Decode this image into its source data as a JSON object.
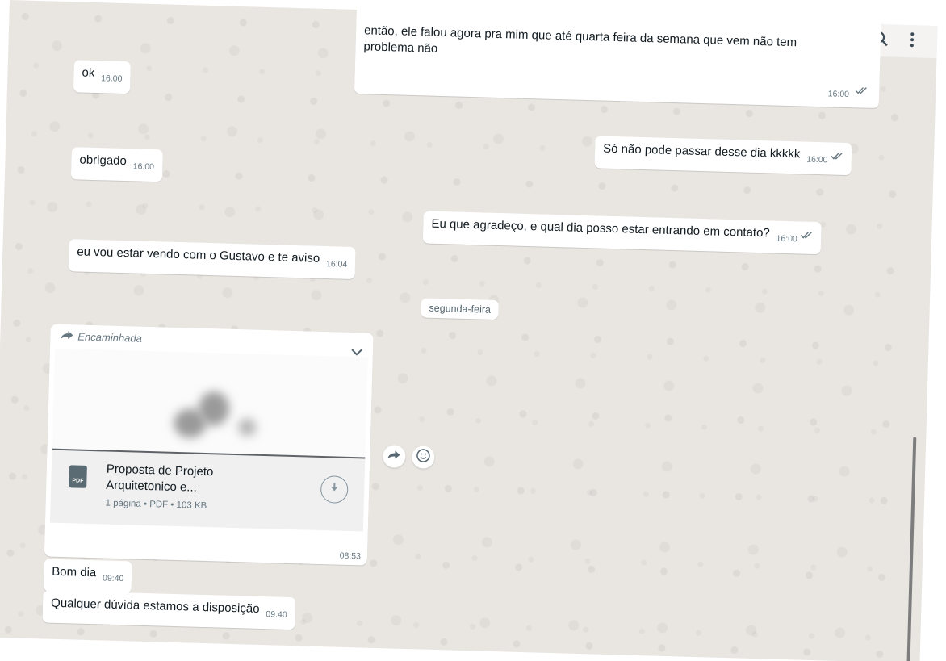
{
  "header": {
    "icons": [
      "video-call-icon",
      "chevron-down-icon",
      "search-icon",
      "menu-dots-icon"
    ]
  },
  "messages": {
    "top_out": {
      "text_line1": "então, ele falou agora pra mim que até quarta feira da semana que vem não tem",
      "text_line2": "problema não",
      "time": "16:00"
    },
    "ok": {
      "text": "ok",
      "time": "16:00"
    },
    "obrigado": {
      "text": "obrigado",
      "time": "16:00"
    },
    "so_nao_pode": {
      "text": "Só não pode passar desse dia kkkkk",
      "time": "16:00"
    },
    "agradeco": {
      "text": "Eu que agradeço, e qual dia posso estar entrando em contato?",
      "time": "16:00"
    },
    "vendo": {
      "text": "eu vou estar vendo com o Gustavo e te aviso",
      "time": "16:04"
    },
    "bom_dia": {
      "text": "Bom dia",
      "time": "09:40"
    },
    "qualquer": {
      "text": "Qualquer dúvida estamos a disposição",
      "time": "09:40"
    }
  },
  "date_divider": "segunda-feira",
  "document": {
    "forwarded_label": "Encaminhada",
    "icon_label": "PDF",
    "title_line1": "Proposta de Projeto",
    "title_line2": "Arquitetonico e...",
    "info": "1 página • PDF • 103 KB",
    "time": "08:53"
  },
  "colors": {
    "background": "#e9e6e2",
    "bubble": "#ffffff",
    "meta_text": "#667781"
  }
}
